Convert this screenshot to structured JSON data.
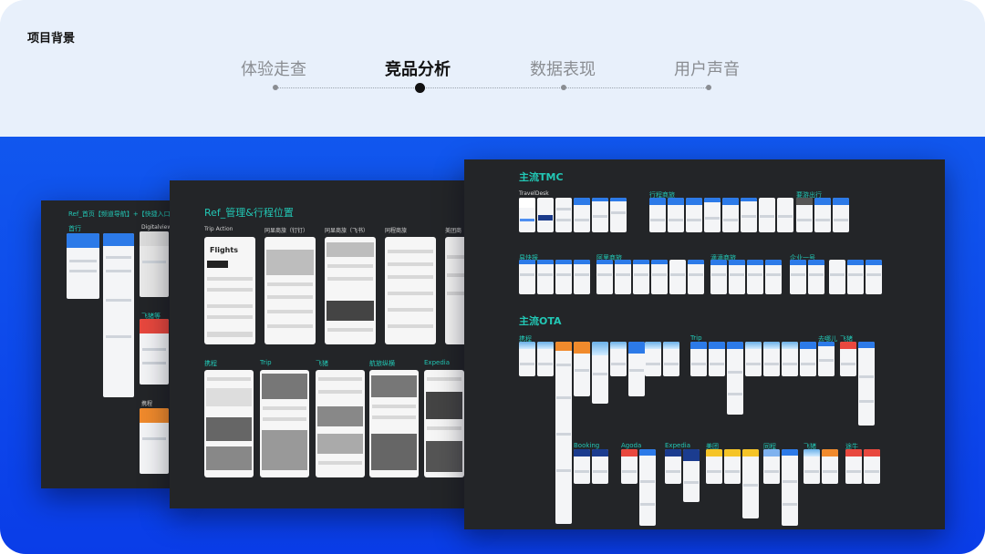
{
  "header": {
    "section_title": "项目背景",
    "tabs": [
      {
        "label": "体验走查",
        "active": false
      },
      {
        "label": "竞品分析",
        "active": true
      },
      {
        "label": "数据表现",
        "active": false
      },
      {
        "label": "用户声音",
        "active": false
      }
    ]
  },
  "colors": {
    "top_bg": "#e8f0fb",
    "bottom_bg": "#0a3de8",
    "board_bg": "#232528",
    "label_teal": "#22c7b5"
  },
  "board_left": {
    "title": "Ref_首页【频道导航】+【快捷入口",
    "labels": [
      "首行",
      "Digitalview",
      "飞猪等",
      "携程"
    ]
  },
  "board_middle": {
    "title": "Ref_管理&行程位置",
    "row1_labels": [
      "Trip Action",
      "同显商旅（钉钉）",
      "同显商旅（飞书）",
      "同程商旅",
      "美团商"
    ],
    "row2_labels": [
      "携程",
      "Trip",
      "飞猪",
      "航旅纵横",
      "Expedia"
    ],
    "wire_titles": [
      "Flights"
    ]
  },
  "board_right": {
    "title_tmc": "主流TMC",
    "title_ota": "主流OTA",
    "tmc_labels": [
      "TravelDesk",
      "行程商旅",
      "易快报",
      "阿里商旅",
      "企业一号",
      "滴滴商旅",
      "要游出行"
    ],
    "ota_labels": [
      "携程",
      "Trip",
      "去哪儿",
      "飞猪",
      "Booking",
      "Agoda",
      "Expedia",
      "美团",
      "同程",
      "飞猪",
      "途牛"
    ]
  }
}
